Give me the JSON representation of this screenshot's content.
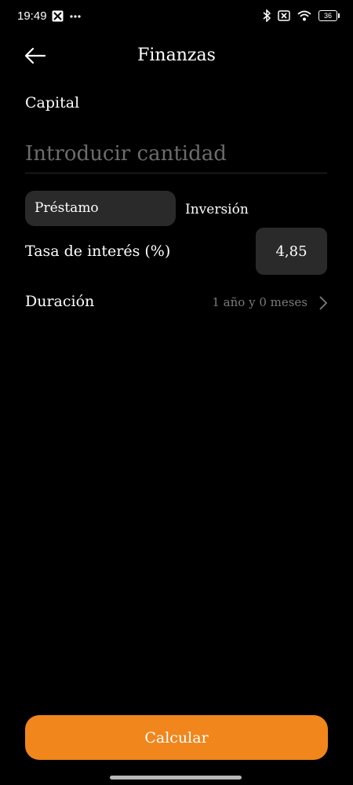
{
  "status": {
    "time": "19:49",
    "battery": "36",
    "icons": [
      "app-notification-icon",
      "more-dots-icon",
      "bluetooth-icon",
      "sim-off-icon",
      "wifi-icon",
      "battery-icon"
    ]
  },
  "header": {
    "title": "Finanzas",
    "back_icon": "back-arrow-icon"
  },
  "capital": {
    "label": "Capital",
    "placeholder": "Introducir cantidad",
    "value": ""
  },
  "tabs": [
    {
      "label": "Préstamo",
      "selected": true
    },
    {
      "label": "Inversión",
      "selected": false
    }
  ],
  "rate": {
    "label": "Tasa de interés (%)",
    "value": "4,85"
  },
  "duration": {
    "label": "Duración",
    "value": "1 año y 0 meses"
  },
  "calculate": {
    "label": "Calcular"
  },
  "colors": {
    "background": "#000000",
    "accent": "#f0861c",
    "control": "#2a2a2a",
    "muted": "#7a7a7a"
  }
}
